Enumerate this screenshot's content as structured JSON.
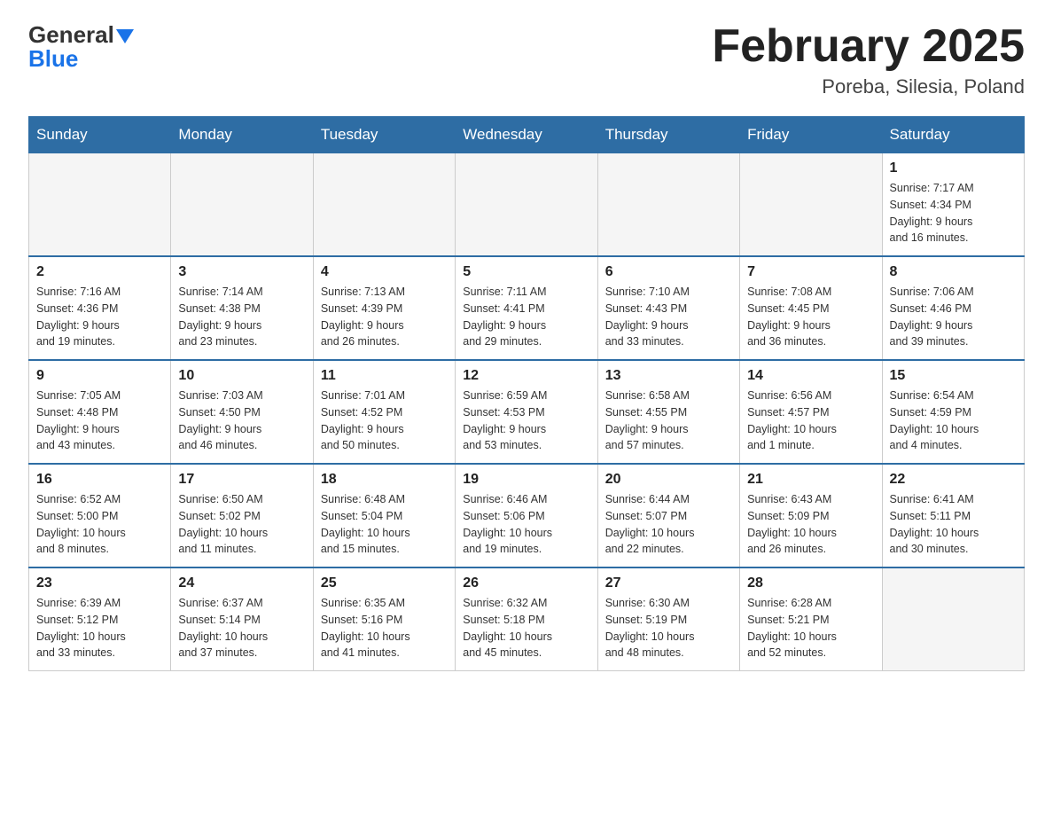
{
  "header": {
    "logo_general": "General",
    "logo_blue": "Blue",
    "month_title": "February 2025",
    "location": "Poreba, Silesia, Poland"
  },
  "days_of_week": [
    "Sunday",
    "Monday",
    "Tuesday",
    "Wednesday",
    "Thursday",
    "Friday",
    "Saturday"
  ],
  "weeks": [
    [
      {
        "day": "",
        "info": ""
      },
      {
        "day": "",
        "info": ""
      },
      {
        "day": "",
        "info": ""
      },
      {
        "day": "",
        "info": ""
      },
      {
        "day": "",
        "info": ""
      },
      {
        "day": "",
        "info": ""
      },
      {
        "day": "1",
        "info": "Sunrise: 7:17 AM\nSunset: 4:34 PM\nDaylight: 9 hours\nand 16 minutes."
      }
    ],
    [
      {
        "day": "2",
        "info": "Sunrise: 7:16 AM\nSunset: 4:36 PM\nDaylight: 9 hours\nand 19 minutes."
      },
      {
        "day": "3",
        "info": "Sunrise: 7:14 AM\nSunset: 4:38 PM\nDaylight: 9 hours\nand 23 minutes."
      },
      {
        "day": "4",
        "info": "Sunrise: 7:13 AM\nSunset: 4:39 PM\nDaylight: 9 hours\nand 26 minutes."
      },
      {
        "day": "5",
        "info": "Sunrise: 7:11 AM\nSunset: 4:41 PM\nDaylight: 9 hours\nand 29 minutes."
      },
      {
        "day": "6",
        "info": "Sunrise: 7:10 AM\nSunset: 4:43 PM\nDaylight: 9 hours\nand 33 minutes."
      },
      {
        "day": "7",
        "info": "Sunrise: 7:08 AM\nSunset: 4:45 PM\nDaylight: 9 hours\nand 36 minutes."
      },
      {
        "day": "8",
        "info": "Sunrise: 7:06 AM\nSunset: 4:46 PM\nDaylight: 9 hours\nand 39 minutes."
      }
    ],
    [
      {
        "day": "9",
        "info": "Sunrise: 7:05 AM\nSunset: 4:48 PM\nDaylight: 9 hours\nand 43 minutes."
      },
      {
        "day": "10",
        "info": "Sunrise: 7:03 AM\nSunset: 4:50 PM\nDaylight: 9 hours\nand 46 minutes."
      },
      {
        "day": "11",
        "info": "Sunrise: 7:01 AM\nSunset: 4:52 PM\nDaylight: 9 hours\nand 50 minutes."
      },
      {
        "day": "12",
        "info": "Sunrise: 6:59 AM\nSunset: 4:53 PM\nDaylight: 9 hours\nand 53 minutes."
      },
      {
        "day": "13",
        "info": "Sunrise: 6:58 AM\nSunset: 4:55 PM\nDaylight: 9 hours\nand 57 minutes."
      },
      {
        "day": "14",
        "info": "Sunrise: 6:56 AM\nSunset: 4:57 PM\nDaylight: 10 hours\nand 1 minute."
      },
      {
        "day": "15",
        "info": "Sunrise: 6:54 AM\nSunset: 4:59 PM\nDaylight: 10 hours\nand 4 minutes."
      }
    ],
    [
      {
        "day": "16",
        "info": "Sunrise: 6:52 AM\nSunset: 5:00 PM\nDaylight: 10 hours\nand 8 minutes."
      },
      {
        "day": "17",
        "info": "Sunrise: 6:50 AM\nSunset: 5:02 PM\nDaylight: 10 hours\nand 11 minutes."
      },
      {
        "day": "18",
        "info": "Sunrise: 6:48 AM\nSunset: 5:04 PM\nDaylight: 10 hours\nand 15 minutes."
      },
      {
        "day": "19",
        "info": "Sunrise: 6:46 AM\nSunset: 5:06 PM\nDaylight: 10 hours\nand 19 minutes."
      },
      {
        "day": "20",
        "info": "Sunrise: 6:44 AM\nSunset: 5:07 PM\nDaylight: 10 hours\nand 22 minutes."
      },
      {
        "day": "21",
        "info": "Sunrise: 6:43 AM\nSunset: 5:09 PM\nDaylight: 10 hours\nand 26 minutes."
      },
      {
        "day": "22",
        "info": "Sunrise: 6:41 AM\nSunset: 5:11 PM\nDaylight: 10 hours\nand 30 minutes."
      }
    ],
    [
      {
        "day": "23",
        "info": "Sunrise: 6:39 AM\nSunset: 5:12 PM\nDaylight: 10 hours\nand 33 minutes."
      },
      {
        "day": "24",
        "info": "Sunrise: 6:37 AM\nSunset: 5:14 PM\nDaylight: 10 hours\nand 37 minutes."
      },
      {
        "day": "25",
        "info": "Sunrise: 6:35 AM\nSunset: 5:16 PM\nDaylight: 10 hours\nand 41 minutes."
      },
      {
        "day": "26",
        "info": "Sunrise: 6:32 AM\nSunset: 5:18 PM\nDaylight: 10 hours\nand 45 minutes."
      },
      {
        "day": "27",
        "info": "Sunrise: 6:30 AM\nSunset: 5:19 PM\nDaylight: 10 hours\nand 48 minutes."
      },
      {
        "day": "28",
        "info": "Sunrise: 6:28 AM\nSunset: 5:21 PM\nDaylight: 10 hours\nand 52 minutes."
      },
      {
        "day": "",
        "info": ""
      }
    ]
  ]
}
